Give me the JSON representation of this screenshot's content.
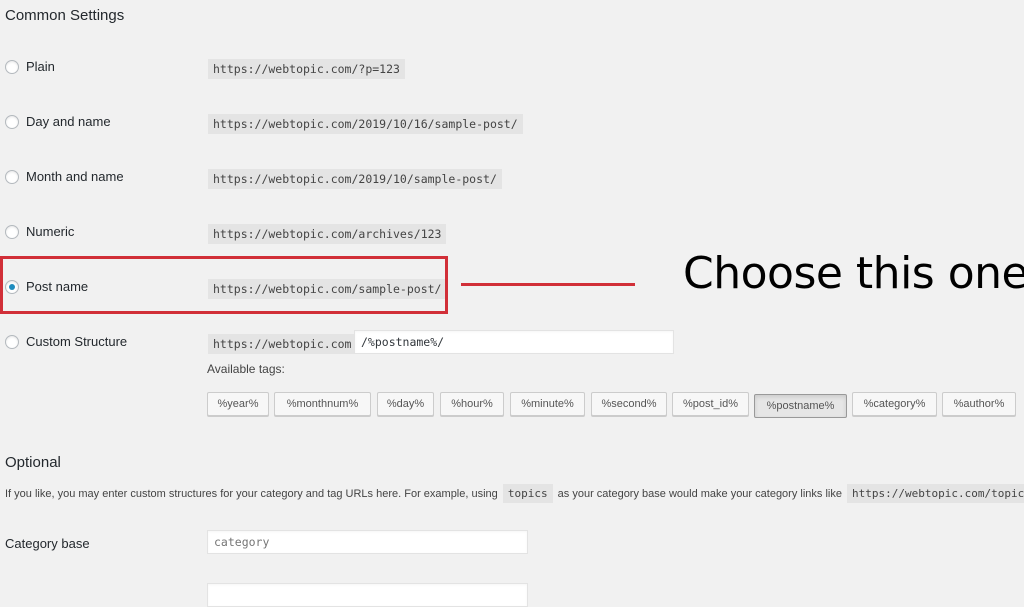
{
  "sections": {
    "common_title": "Common Settings",
    "optional_title": "Optional"
  },
  "permalink_options": [
    {
      "label": "Plain",
      "example": "https://webtopic.com/?p=123",
      "checked": false
    },
    {
      "label": "Day and name",
      "example": "https://webtopic.com/2019/10/16/sample-post/",
      "checked": false
    },
    {
      "label": "Month and name",
      "example": "https://webtopic.com/2019/10/sample-post/",
      "checked": false
    },
    {
      "label": "Numeric",
      "example": "https://webtopic.com/archives/123",
      "checked": false
    },
    {
      "label": "Post name",
      "example": "https://webtopic.com/sample-post/",
      "checked": true
    },
    {
      "label": "Custom Structure",
      "example": "https://webtopic.com",
      "checked": false
    }
  ],
  "custom_structure": {
    "value": "/%postname%/",
    "available_tags_label": "Available tags:",
    "tags": [
      "%year%",
      "%monthnum%",
      "%day%",
      "%hour%",
      "%minute%",
      "%second%",
      "%post_id%",
      "%postname%",
      "%category%",
      "%author%"
    ],
    "active_tag": "%postname%"
  },
  "optional": {
    "help_before": "If you like, you may enter custom structures for your category and tag URLs here. For example, using",
    "help_code1": "topics",
    "help_middle": "as your category base would make your category links like",
    "help_code2": "https://webtopic.com/topics/uncategorized/",
    "category_base_label": "Category base",
    "category_base_placeholder": "category"
  },
  "annotation": {
    "text": "Choose this one",
    "color": "#d12f38"
  }
}
